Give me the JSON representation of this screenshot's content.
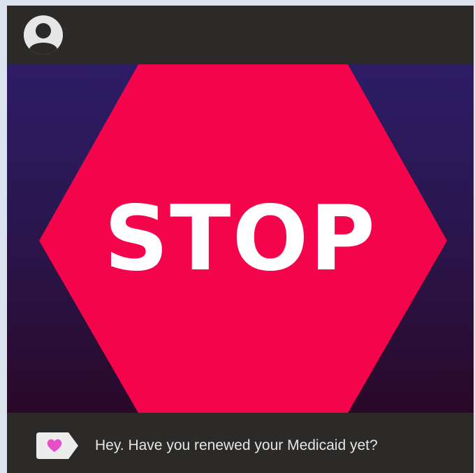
{
  "hero": {
    "headline": "STOP"
  },
  "caption": {
    "text": "Hey. Have you renewed your Medicaid yet?"
  },
  "icons": {
    "avatar": "user-avatar-icon",
    "tag": "heart-tag-icon"
  },
  "colors": {
    "octagon_fill": "#f4044a",
    "heart": "#e64fc7",
    "header_bg": "#2b2a29",
    "gradient_top": "#2d1d66",
    "gradient_bottom": "#2a0828"
  }
}
